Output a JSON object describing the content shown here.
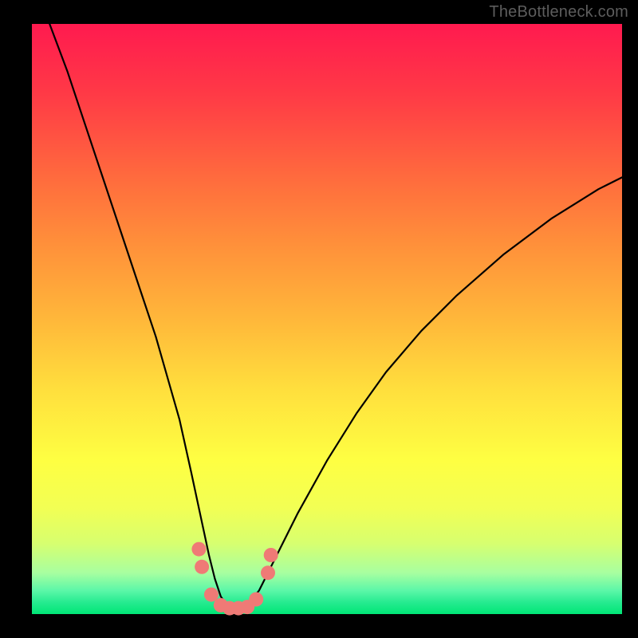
{
  "watermark": "TheBottleneck.com",
  "chart_data": {
    "type": "line",
    "title": "",
    "xlabel": "",
    "ylabel": "",
    "xlim": [
      0,
      100
    ],
    "ylim": [
      0,
      100
    ],
    "series": [
      {
        "name": "bottleneck-curve",
        "x": [
          3,
          6,
          9,
          12,
          15,
          18,
          21,
          23,
          25,
          27,
          28.5,
          30,
          31,
          32,
          33,
          34,
          35,
          36,
          37,
          38.5,
          40,
          42,
          45,
          50,
          55,
          60,
          66,
          72,
          80,
          88,
          96,
          100
        ],
        "y": [
          100,
          92,
          83,
          74,
          65,
          56,
          47,
          40,
          33,
          24,
          17,
          10,
          6,
          3,
          1.5,
          1,
          1,
          1.3,
          2.2,
          4,
          7,
          11,
          17,
          26,
          34,
          41,
          48,
          54,
          61,
          67,
          72,
          74
        ]
      }
    ],
    "markers": {
      "name": "highlight-dots",
      "color": "#ef7a76",
      "points": [
        {
          "x": 28.3,
          "y": 11.0
        },
        {
          "x": 28.8,
          "y": 8.0
        },
        {
          "x": 30.4,
          "y": 3.3
        },
        {
          "x": 32.0,
          "y": 1.5
        },
        {
          "x": 33.5,
          "y": 1.0
        },
        {
          "x": 35.0,
          "y": 1.0
        },
        {
          "x": 36.5,
          "y": 1.2
        },
        {
          "x": 38.0,
          "y": 2.5
        },
        {
          "x": 40.0,
          "y": 7.0
        },
        {
          "x": 40.5,
          "y": 10.0
        }
      ]
    }
  }
}
